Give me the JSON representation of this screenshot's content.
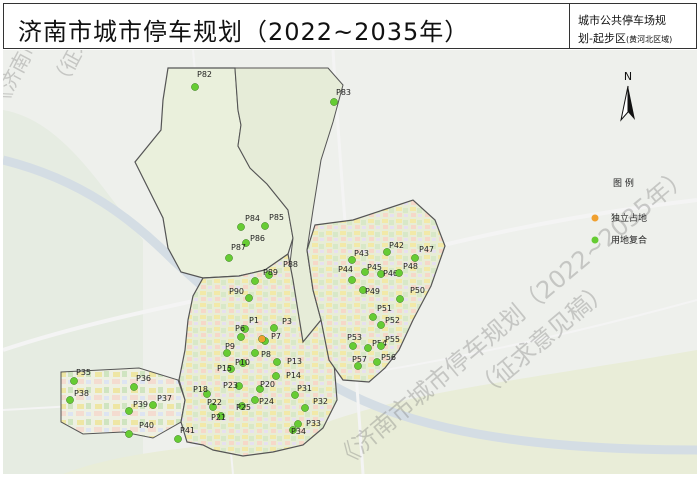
{
  "header": {
    "title": "济南市城市停车规划（2022~2035年）",
    "subtitle_line1": "城市公共停车场规",
    "subtitle_line2": "划-起步区",
    "subtitle_line2_small": "(黄河北区域)"
  },
  "north_arrow": {
    "label": "N"
  },
  "legend": {
    "title": "图    例",
    "items": [
      {
        "label": "独立占地",
        "color": "#f0a030"
      },
      {
        "label": "用地复合",
        "color": "#66cc33"
      }
    ]
  },
  "watermarks": [
    "《济南市城市停车规划（2022~2035年）",
    "（征求意见稿）",
    "《济南市城市停车规划（2022~2035年）",
    "（征求意见稿）"
  ],
  "colors": {
    "independent": "#f0a030",
    "composite": "#66cc33"
  },
  "parking": [
    {
      "id": "P82",
      "type": "composite"
    },
    {
      "id": "P83",
      "type": "composite"
    },
    {
      "id": "P84",
      "type": "composite"
    },
    {
      "id": "P85",
      "type": "composite"
    },
    {
      "id": "P86",
      "type": "composite"
    },
    {
      "id": "P87",
      "type": "composite"
    },
    {
      "id": "P88",
      "type": "composite"
    },
    {
      "id": "P89",
      "type": "composite"
    },
    {
      "id": "P90",
      "type": "composite"
    },
    {
      "id": "P1",
      "type": "composite"
    },
    {
      "id": "P3",
      "type": "composite"
    },
    {
      "id": "P6",
      "type": "composite"
    },
    {
      "id": "P7",
      "type": "composite"
    },
    {
      "id": "P8",
      "type": "composite"
    },
    {
      "id": "P9",
      "type": "composite"
    },
    {
      "id": "P10",
      "type": "composite"
    },
    {
      "id": "P13",
      "type": "composite"
    },
    {
      "id": "P14",
      "type": "composite"
    },
    {
      "id": "P15",
      "type": "composite"
    },
    {
      "id": "P18",
      "type": "composite"
    },
    {
      "id": "P20",
      "type": "composite"
    },
    {
      "id": "P21",
      "type": "composite"
    },
    {
      "id": "P22",
      "type": "composite"
    },
    {
      "id": "P23",
      "type": "composite"
    },
    {
      "id": "P24",
      "type": "composite"
    },
    {
      "id": "P25",
      "type": "composite"
    },
    {
      "id": "P31",
      "type": "composite"
    },
    {
      "id": "P32",
      "type": "composite"
    },
    {
      "id": "P33",
      "type": "composite"
    },
    {
      "id": "P34",
      "type": "composite"
    },
    {
      "id": "P35",
      "type": "composite"
    },
    {
      "id": "P36",
      "type": "composite"
    },
    {
      "id": "P37",
      "type": "composite"
    },
    {
      "id": "P38",
      "type": "composite"
    },
    {
      "id": "P39",
      "type": "composite"
    },
    {
      "id": "P40",
      "type": "composite"
    },
    {
      "id": "P41",
      "type": "composite"
    },
    {
      "id": "P42",
      "type": "composite"
    },
    {
      "id": "P43",
      "type": "composite"
    },
    {
      "id": "P44",
      "type": "composite"
    },
    {
      "id": "P45",
      "type": "composite"
    },
    {
      "id": "P46",
      "type": "composite"
    },
    {
      "id": "P47",
      "type": "composite"
    },
    {
      "id": "P48",
      "type": "composite"
    },
    {
      "id": "P49",
      "type": "composite"
    },
    {
      "id": "P50",
      "type": "composite"
    },
    {
      "id": "P51",
      "type": "composite"
    },
    {
      "id": "P52",
      "type": "composite"
    },
    {
      "id": "P53",
      "type": "composite"
    },
    {
      "id": "P54",
      "type": "composite"
    },
    {
      "id": "P55",
      "type": "composite"
    },
    {
      "id": "P56",
      "type": "composite"
    },
    {
      "id": "P57",
      "type": "composite"
    },
    {
      "id": "P2",
      "type": "independent"
    }
  ]
}
